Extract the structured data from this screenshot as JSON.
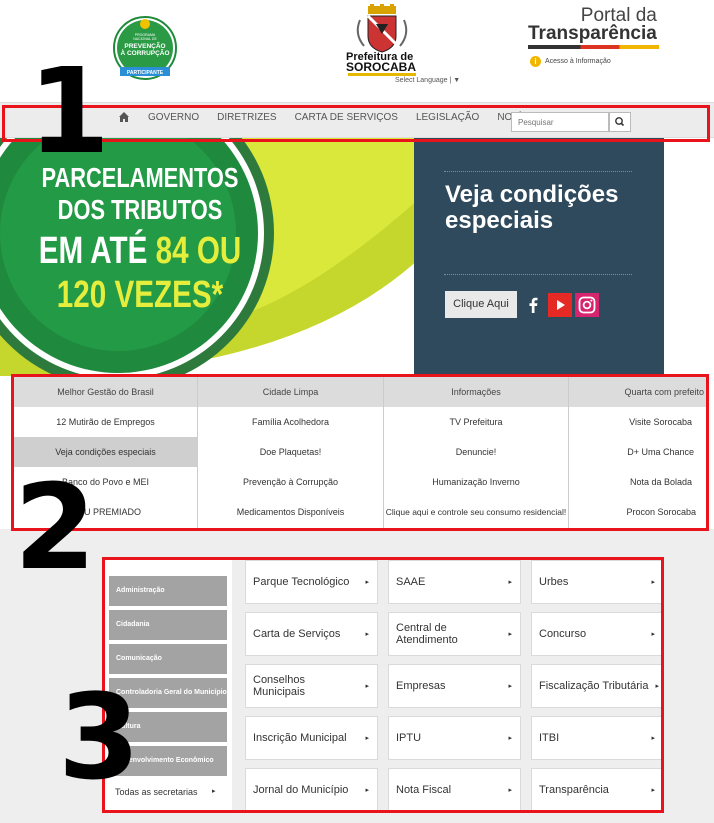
{
  "header": {
    "seal_text": [
      "PROGRAMA",
      "NACIONAL DE",
      "PREVENÇÃO",
      "À CORRUPÇÃO",
      "PARTICIPANTE"
    ],
    "city_prefix": "Prefeitura de",
    "city_name": "SOROCABA",
    "select_language": "Select Language",
    "portal_line1": "Portal da",
    "portal_line2": "Transparência",
    "access_info": "Acesso à Informação"
  },
  "nav": {
    "home_icon": "home-icon",
    "items": [
      "GOVERNO",
      "DIRETRIZES",
      "CARTA DE SERVIÇOS",
      "LEGISLAÇÃO",
      "NOTÍCIAS"
    ],
    "search_placeholder": "Pesquisar",
    "search_icon": "search-icon"
  },
  "banner": {
    "line1": "PARCELAMENTOS",
    "line2": "DOS TRIBUTOS",
    "line3_a": "EM ATÉ ",
    "line3_b": "84 OU",
    "line4": "120 VEZES*",
    "promo_title": "Veja condições especiais",
    "promo_button": "Clique Aqui",
    "social_icons": [
      "facebook-icon",
      "youtube-icon",
      "instagram-icon"
    ]
  },
  "quick_links": {
    "columns": [
      {
        "header": "Melhor Gestão do Brasil",
        "items": [
          "12 Mutirão de Empregos",
          "Veja condições especiais",
          "Banco do Povo e MEI",
          "IPTU PREMIADO"
        ]
      },
      {
        "header": "Cidade Limpa",
        "items": [
          "Família Acolhedora",
          "Doe Plaquetas!",
          "Prevenção à Corrupção",
          "Medicamentos Disponíveis"
        ]
      },
      {
        "header": "Informações",
        "items": [
          "TV Prefeitura",
          "Denuncie!",
          "Humanização Inverno",
          "Clique aqui e controle seu consumo residencial!"
        ]
      },
      {
        "header": "Quarta com prefeito",
        "items": [
          "Visite Sorocaba",
          "D+ Uma Chance",
          "Nota da Bolada",
          "Procon Sorocaba"
        ]
      }
    ]
  },
  "secretarias": {
    "items": [
      "Administração",
      "Cidadania",
      "Comunicação",
      "Controladoria Geral do Município",
      "Cultura",
      "Desenvolvimento Econômico"
    ],
    "all_label": "Todas as secretarias"
  },
  "services": {
    "rows": [
      [
        "Parque Tecnológico",
        "SAAE",
        "Urbes"
      ],
      [
        "Carta de Serviços",
        "Central de Atendimento",
        "Concurso"
      ],
      [
        "Conselhos Municipais",
        "Empresas",
        "Fiscalização Tributária"
      ],
      [
        "Inscrição Municipal",
        "IPTU",
        "ITBI"
      ],
      [
        "Jornal do Município",
        "Nota Fiscal",
        "Transparência"
      ]
    ]
  },
  "annotations": [
    "1",
    "2",
    "3"
  ],
  "colors": {
    "annotation_red": "#e8131b",
    "promo_bg": "#2f4a5c",
    "green": "#1e8a3a",
    "lime": "#d9e83a"
  }
}
